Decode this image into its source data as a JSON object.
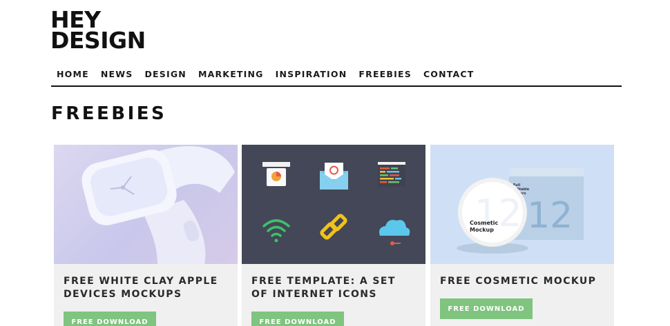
{
  "logo": {
    "line1": "HEY",
    "line2": "DESIGN"
  },
  "nav": [
    "HOME",
    "NEWS",
    "DESIGN",
    "MARKETING",
    "INSPIRATION",
    "FREEBIES",
    "CONTACT"
  ],
  "page_title": "FREEBIES",
  "cards": [
    {
      "title": "FREE WHITE CLAY APPLE DEVICES MOCKUPS",
      "button": "FREE DOWNLOAD"
    },
    {
      "title": "FREE TEMPLATE: A SET OF INTERNET ICONS",
      "button": "FREE DOWNLOAD"
    },
    {
      "title": "FREE COSMETIC MOCKUP",
      "button": "FREE DOWNLOAD",
      "image_text": {
        "jar_number": "12",
        "jar_label_line1": "Cosmetic",
        "jar_label_line2": "Mockup",
        "box_number": "12",
        "box_label_line1": "Full",
        "box_label_line2": "Editable",
        "box_label_line3": "Layers"
      }
    }
  ],
  "colors": {
    "button": "#7fc47f",
    "card_bg": "#f0f0f0",
    "icon_panel": "#434757"
  }
}
